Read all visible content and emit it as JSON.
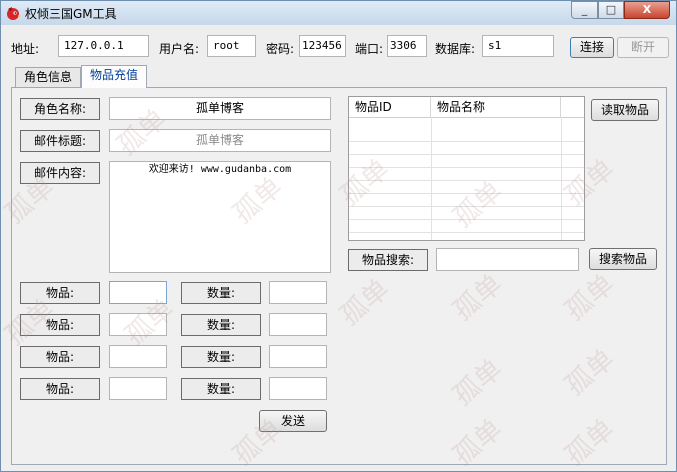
{
  "window": {
    "title": "权倾三国GM工具",
    "minimize": "_",
    "maximize": "□",
    "close": "X"
  },
  "connection": {
    "address_label": "地址:",
    "address_value": "127.0.0.1",
    "username_label": "用户名:",
    "username_value": "root",
    "password_label": "密码:",
    "password_value": "123456",
    "port_label": "端口:",
    "port_value": "3306",
    "database_label": "数据库:",
    "database_value": "s1",
    "connect_label": "连接",
    "disconnect_label": "断开"
  },
  "tabs": [
    {
      "label": "角色信息"
    },
    {
      "label": "物品充值"
    }
  ],
  "mail": {
    "role_name_label": "角色名称:",
    "role_name_value": "孤单博客",
    "mail_title_label": "邮件标题:",
    "mail_title_value": "孤单博客",
    "mail_content_label": "邮件内容:",
    "mail_content_value": "欢迎来访! www.gudanba.com"
  },
  "items": [
    {
      "item_label": "物品:",
      "qty_label": "数量:",
      "item_value": "",
      "qty_value": ""
    },
    {
      "item_label": "物品:",
      "qty_label": "数量:",
      "item_value": "",
      "qty_value": ""
    },
    {
      "item_label": "物品:",
      "qty_label": "数量:",
      "item_value": "",
      "qty_value": ""
    },
    {
      "item_label": "物品:",
      "qty_label": "数量:",
      "item_value": "",
      "qty_value": ""
    }
  ],
  "send_label": "发送",
  "item_table": {
    "columns": [
      "物品ID",
      "物品名称"
    ],
    "rows": []
  },
  "read_items_label": "读取物品",
  "search": {
    "label": "物品搜索:",
    "value": "",
    "button": "搜索物品"
  },
  "watermark": "孤单",
  "colors": {
    "titlebar": "#c7d8ea",
    "close": "#c8452f",
    "active_tab_text": "#003e9b",
    "watermark": "#be9696"
  }
}
